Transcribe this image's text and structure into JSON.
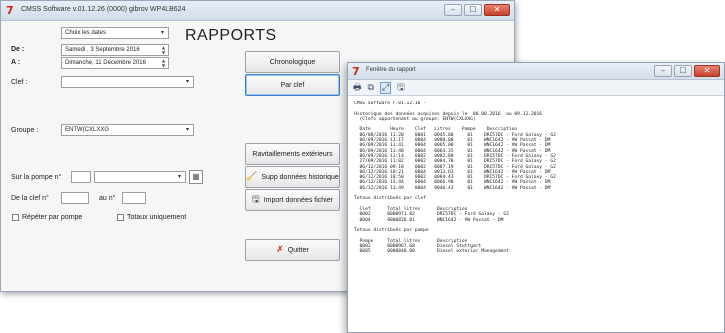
{
  "main_window": {
    "title": "CMSS Software v.01.12.26 (0000) gibrov WP4LB624",
    "heading": "RAPPORTS",
    "period_select": "Choix les dates",
    "de_label": "De :",
    "de_value": "Samedi ,  3 Septembre 2016",
    "a_label": "A :",
    "a_value": "Dimanche,  11 Décembre 2016",
    "clef_label": "Clef :",
    "clef_value": "",
    "groupe_label": "Groupe :",
    "groupe_value": "ENTW(CXLXXG",
    "pompe_label": "Sur la pompe n°",
    "pompe_value": "",
    "de_clef_label": "De la clef n°",
    "au_label": "au n°",
    "repeter_label": "Répéter par pompe",
    "totaux_label": "Totaux uniquement",
    "buttons": {
      "chronologique": "Chronologique",
      "par_clef": "Par clef",
      "ravitaillements": "Ravitaillements extérieurs",
      "suppression": "Supp données historique",
      "import": "Import données fichier",
      "quitter": "Quitter"
    }
  },
  "report_window": {
    "title": "Fenêtre du rapport",
    "lines": [
      "CMSS Software r.01.12.16 -",
      "",
      "Historique des données acquises depuis le  00.00.2016  au 09.12.2016",
      "  (Clefs appartenant au groupe: ENTW(CXLXXG)",
      "",
      "  Date       Heure    Clef   Litres    Pompe    Description",
      "  06/08/2016 11:20    0001   0045.00     01    DRI57DC - Ford Galaxy - G2",
      "  06/09/2016 11:17    0004   0080.00     01    WNC1642 - VW Passat - DM",
      "  06/09/2016 11:41    0004   0065.00     01    WNC1642 - VW Passat - DM",
      "  06/09/2016 11:48    0004   0064.35     01    WNC1642 - VW Passat - DM",
      "  06/09/2016 11:14    0002   0082.88     01    DRI57DC - Ford Galaxy - G2",
      "  27/09/2016 11:02    0002   0084.70     01    DRI57DC - Ford Galaxy - G2",
      "  06/12/2016 09:18    0002   0087.19     01    DRI57DC - Ford Galaxy - G2",
      "  06/12/2016 10:21    0004   0013.63     01    WNC1642 - VW Passat - DM",
      "  06/12/2016 10:50    0002   0084.43     01    DRI57DC - Ford Galaxy - G2",
      "  06/12/2016 13:44    0004   0066.90     01    WNC1642 - VW Passat - DM",
      "  06/12/2016 13:49    0004   0046.43     01    WNC1642 - VW Passat - DM",
      "",
      "Totaux distribués par clef",
      "",
      "  Clef      Total litres      Description",
      "  0002      0000971.02        DRI57DC - Ford Galaxy - G2",
      "  0004      0000826.01        WNC1642 - VW Passat - DM",
      "",
      "Totaux distribués par pompe",
      "",
      "  Pompe     Total litres      Description",
      "  0002      0000967.68        Diesel Stuttgart",
      "  0085      0000840.00        Diesel exterior Management"
    ]
  }
}
